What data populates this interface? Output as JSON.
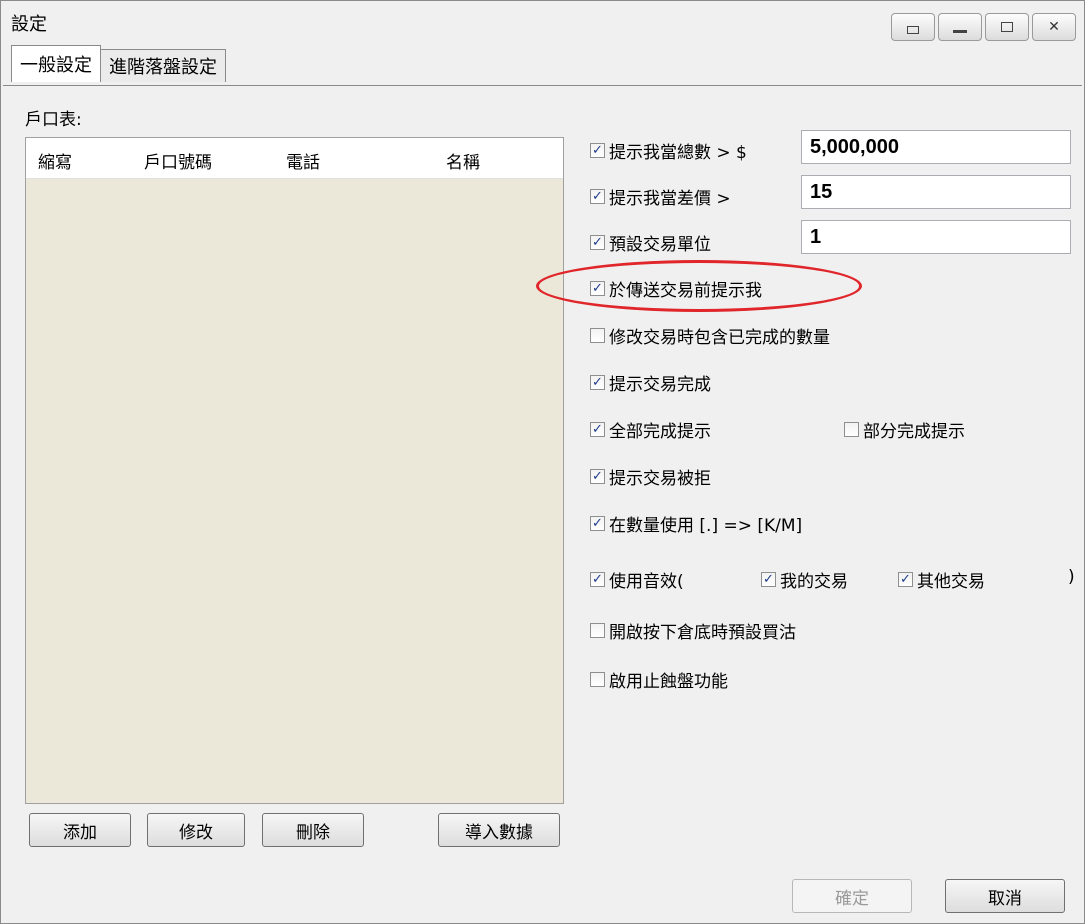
{
  "window": {
    "title": "設定"
  },
  "tabs": [
    "一般設定",
    "進階落盤設定"
  ],
  "account_list": {
    "label": "戶口表:",
    "columns": [
      "縮寫",
      "戶口號碼",
      "電話",
      "名稱"
    ],
    "rows": []
  },
  "list_buttons": {
    "add": "添加",
    "edit": "修改",
    "delete": "刪除",
    "import": "導入數據"
  },
  "settings": {
    "total_alert": {
      "label": "提示我當總數 > $",
      "checked": true,
      "value": "5,000,000"
    },
    "diff_alert": {
      "label": "提示我當差價 >",
      "checked": true,
      "value": "15"
    },
    "default_unit": {
      "label": "預設交易單位",
      "checked": true,
      "value": "1"
    },
    "confirm_before_send": {
      "label": "於傳送交易前提示我",
      "checked": true
    },
    "include_filled_qty": {
      "label": "修改交易時包含已完成的數量",
      "checked": false
    },
    "trade_done_alert": {
      "label": "提示交易完成",
      "checked": true
    },
    "full_done_alert": {
      "label": "全部完成提示",
      "checked": true
    },
    "partial_done_alert": {
      "label": "部分完成提示",
      "checked": false
    },
    "rejected_alert": {
      "label": "提示交易被拒",
      "checked": true
    },
    "qty_shortcut": {
      "label": "在數量使用 [.] => [K/M]",
      "checked": true
    },
    "sound": {
      "label": "使用音效(",
      "checked": true,
      "close_paren": ")"
    },
    "sound_my_trades": {
      "label": "我的交易",
      "checked": true
    },
    "sound_other_trades": {
      "label": "其他交易",
      "checked": true
    },
    "bottom_default_buy_sell": {
      "label": "開啟按下倉底時預設買沽",
      "checked": false
    },
    "stop_loss": {
      "label": "啟用止蝕盤功能",
      "checked": false
    }
  },
  "dialog_buttons": {
    "ok": "確定",
    "cancel": "取消"
  },
  "colors": {
    "highlight_ellipse": "#e0262b",
    "list_background": "#ece8d9",
    "check_mark": "#1e3b8c"
  }
}
